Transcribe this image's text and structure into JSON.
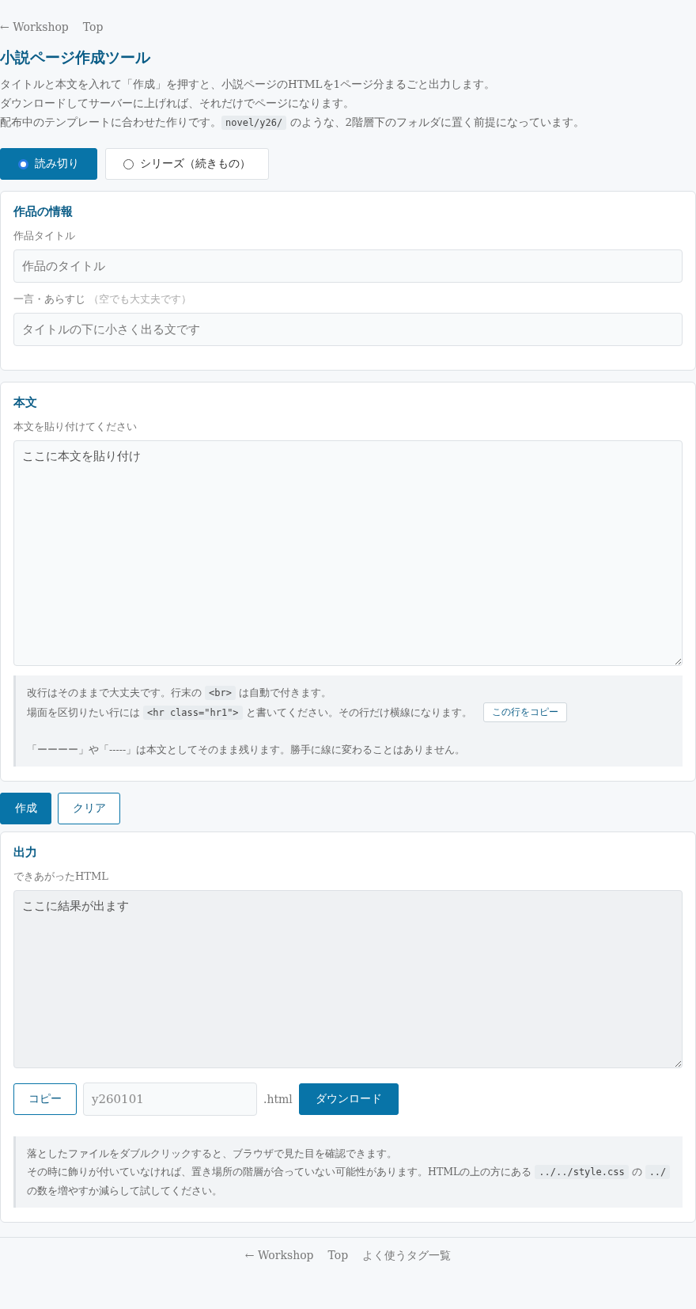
{
  "top_nav": [
    "← Workshop",
    "Top"
  ],
  "title": "小説ページ作成ツール",
  "intro": [
    [
      {
        "kind": "text",
        "text": "タイトルと本文を入れて「作成」を押すと、小説ページのHTMLを1ページ分まるごと出力します。"
      }
    ],
    [
      {
        "kind": "text",
        "text": "ダウンロードしてサーバーに上げれば、それだけでページになります。"
      }
    ],
    [
      {
        "kind": "text",
        "text": "配布中のテンプレートに合わせた作りです。"
      },
      {
        "kind": "code",
        "text": "novel/y26/"
      },
      {
        "kind": "text",
        "text": " のような、2階層下のフォルダに置く前提になっています。"
      }
    ]
  ],
  "modes": [
    {
      "label": "読み切り",
      "selected": true
    },
    {
      "label": "シリーズ（続きもの）",
      "selected": false
    }
  ],
  "info_card": {
    "heading": "作品の情報",
    "fields": [
      {
        "label": "作品タイトル",
        "placeholder": "作品のタイトル"
      },
      {
        "label": "一言・あらすじ",
        "note": "（空でも大丈夫です）",
        "placeholder": "タイトルの下に小さく出る文です"
      }
    ]
  },
  "body_card": {
    "heading": "本文",
    "label": "本文を貼り付けてください",
    "placeholder": "ここに本文を貼り付け",
    "hint_lines": [
      [
        {
          "kind": "text",
          "text": "改行はそのままで大丈夫です。行末の "
        },
        {
          "kind": "code",
          "text": "<br>"
        },
        {
          "kind": "text",
          "text": " は自動で付きます。"
        }
      ],
      [
        {
          "kind": "text",
          "text": "場面を区切りたい行には "
        },
        {
          "kind": "code",
          "text": "<hr class=\"hr1\">"
        },
        {
          "kind": "text",
          "text": " と書いてください。その行だけ横線になります。"
        }
      ],
      [
        {
          "kind": "text",
          "text": "「ーーーー」や「-----」は本文としてそのまま残ります。勝手に線に変わることはありません。"
        }
      ]
    ],
    "copy_line_button": "この行をコピー"
  },
  "actions": [
    {
      "label": "作成",
      "kind": "primary"
    },
    {
      "label": "クリア",
      "kind": "outline"
    }
  ],
  "output_card": {
    "heading": "出力",
    "label": "できあがったHTML",
    "placeholder": "ここに結果が出ます",
    "copy_button": "コピー",
    "filename_placeholder": "y260101",
    "extension": ".html",
    "download_button": "ダウンロード",
    "note_lines": [
      [
        {
          "kind": "text",
          "text": "落としたファイルをダブルクリックすると、ブラウザで見た目を確認できます。"
        }
      ],
      [
        {
          "kind": "text",
          "text": "その時に飾りが付いていなければ、置き場所の階層が合っていない可能性があります。HTMLの上の方にある "
        },
        {
          "kind": "code",
          "text": "../../style.css"
        },
        {
          "kind": "text",
          "text": " の "
        },
        {
          "kind": "code",
          "text": "../"
        },
        {
          "kind": "text",
          "text": " の数を増やすか減らして試してください。"
        }
      ]
    ]
  },
  "footer_nav": [
    "← Workshop",
    "Top",
    "よく使うタグ一覧"
  ]
}
